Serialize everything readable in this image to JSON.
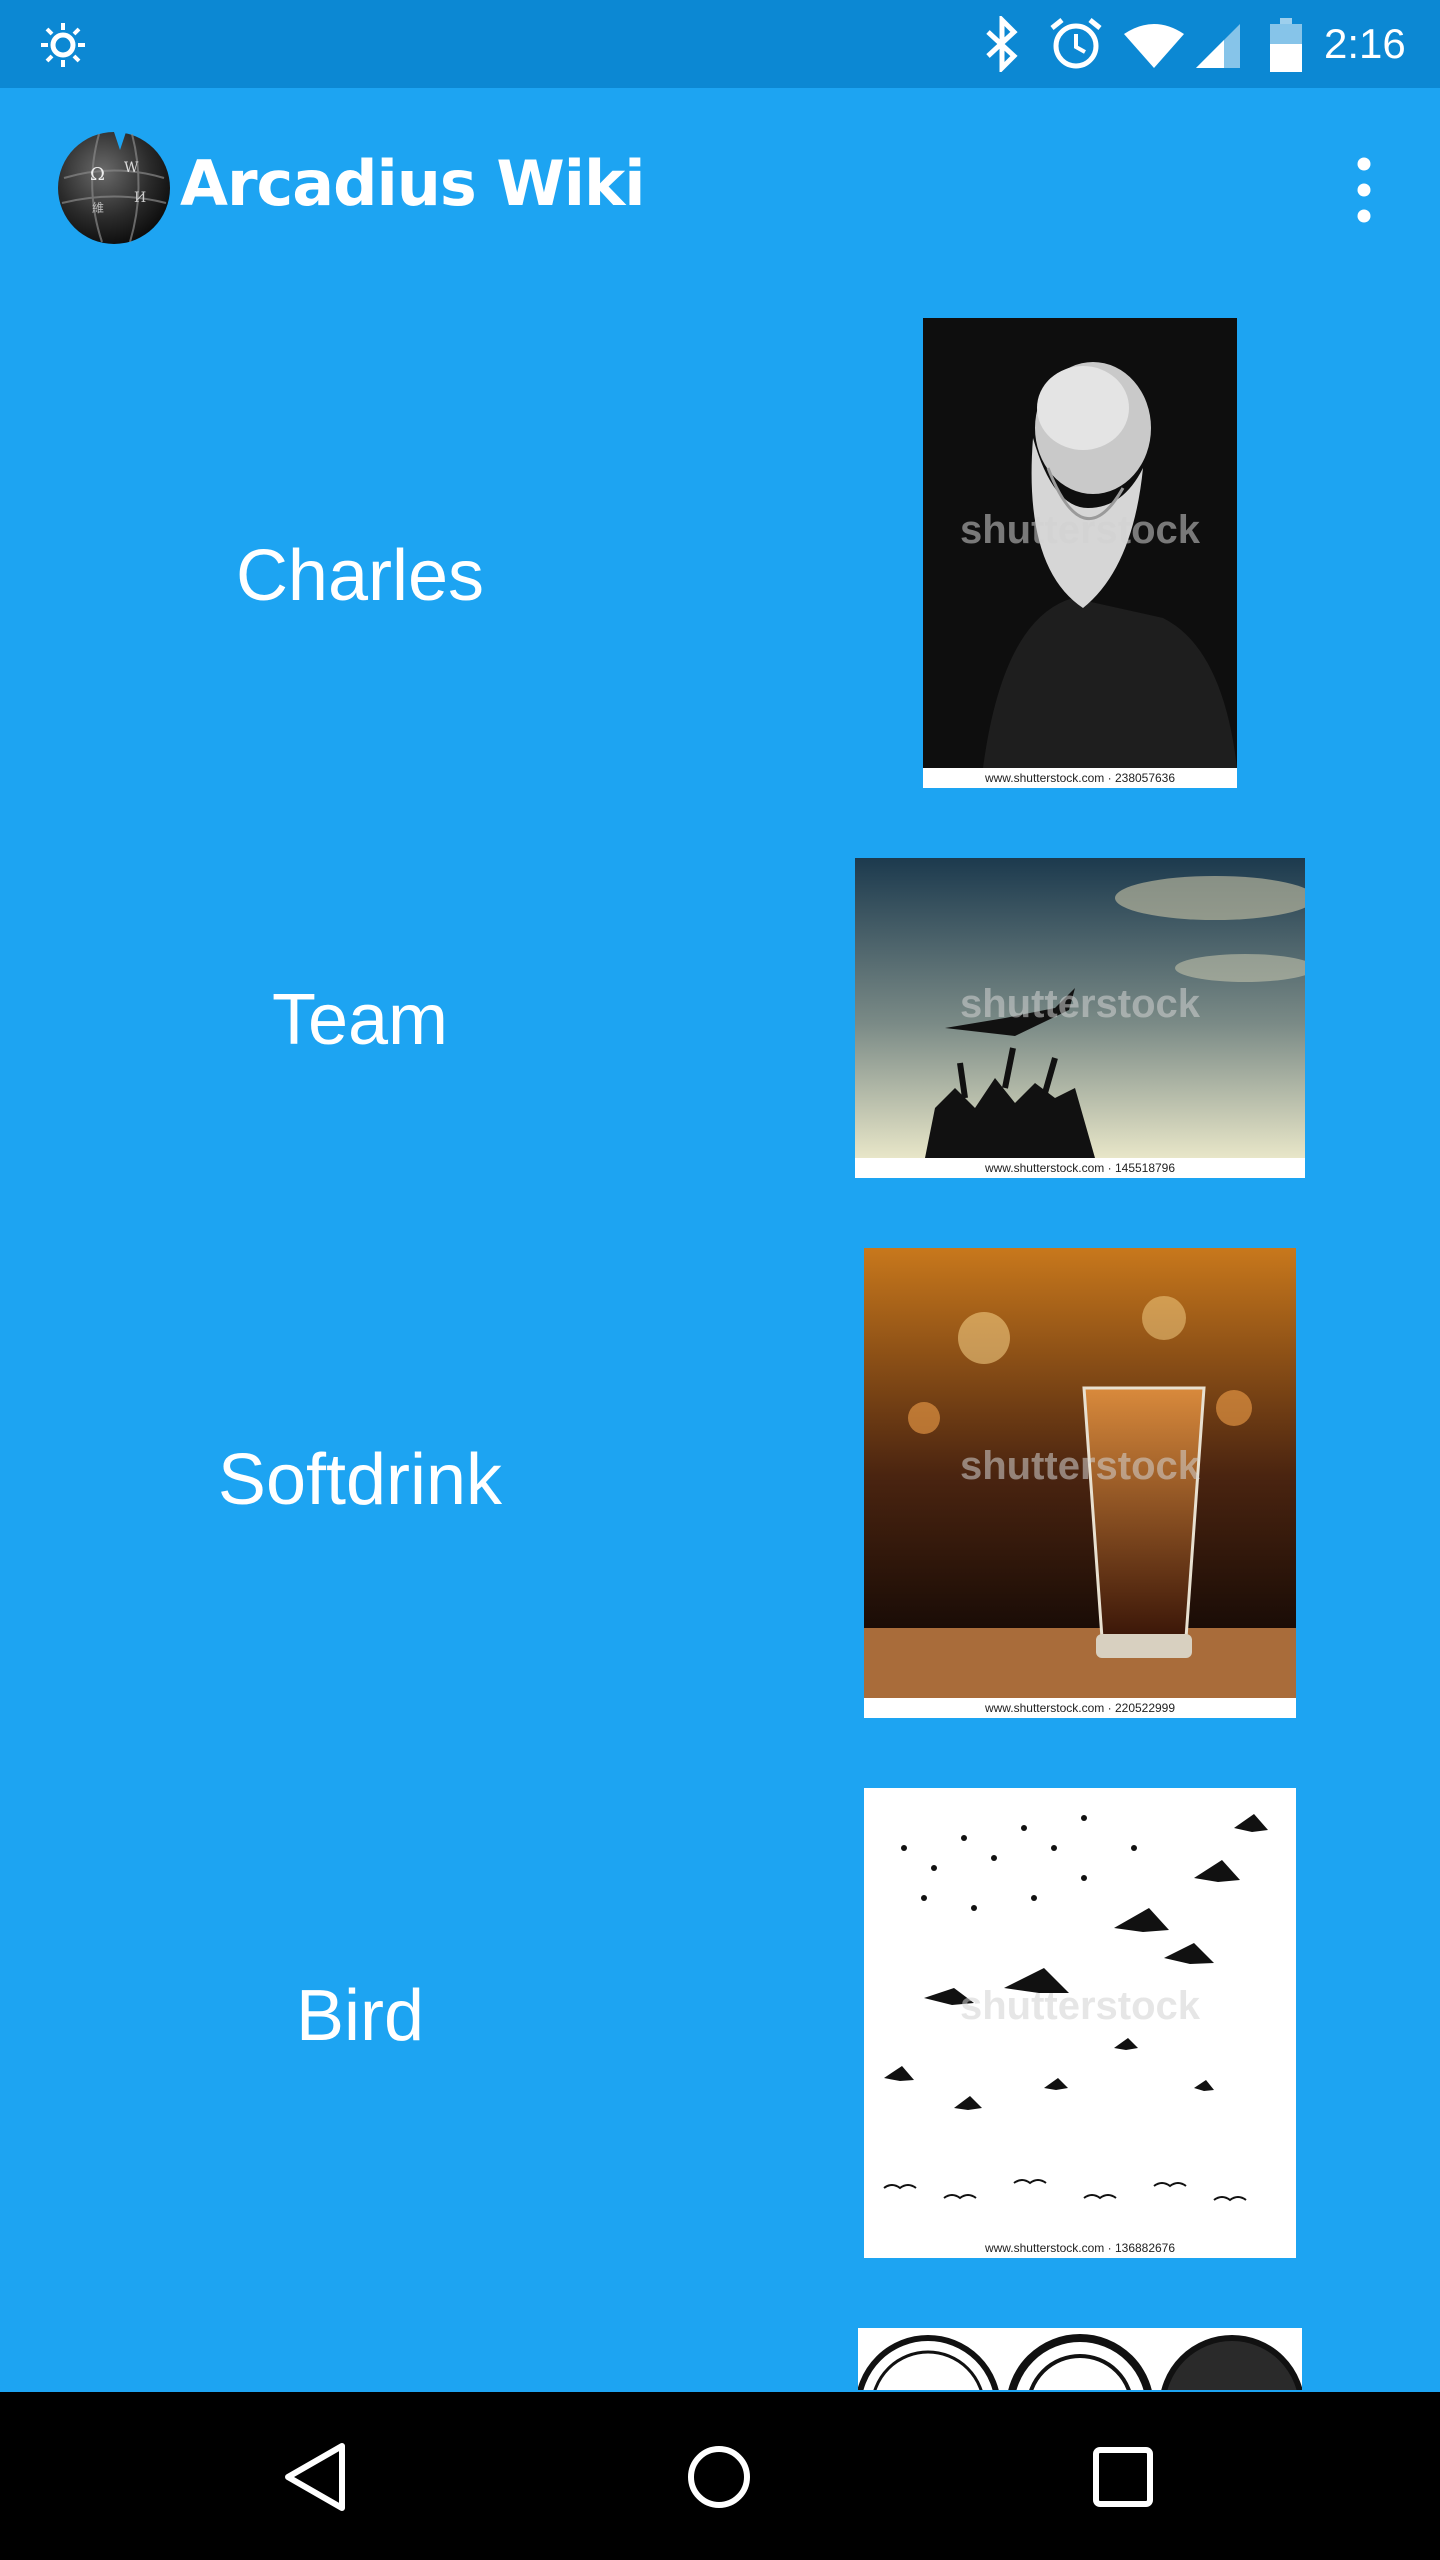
{
  "status_bar": {
    "time": "2:16",
    "icons": [
      "brightness-icon",
      "bluetooth-icon",
      "alarm-icon",
      "wifi-icon",
      "cell-signal-icon",
      "battery-icon"
    ]
  },
  "app_bar": {
    "title": "Arcadius Wiki",
    "logo": "wikipedia-globe-logo",
    "menu_icon": "overflow-menu-icon"
  },
  "items": [
    {
      "label": "Charles",
      "image": "portrait of bearded man",
      "watermark": "shutterstock",
      "credit": "www.shutterstock.com · 238057636"
    },
    {
      "label": "Team",
      "image": "crowd throwing person in air at sunset",
      "watermark": "shutterstock",
      "credit": "www.shutterstock.com · 145518796"
    },
    {
      "label": "Softdrink",
      "image": "glass of cola on bar",
      "watermark": "shutterstock",
      "credit": "www.shutterstock.com · 220522999"
    },
    {
      "label": "Bird",
      "image": "flock of bird silhouettes",
      "watermark": "shutterstock",
      "credit": "www.shutterstock.com · 136882676"
    }
  ],
  "colors": {
    "background": "#1da4f2",
    "status_bar": "#0c88d3",
    "nav_bar": "#000000",
    "text": "#ffffff"
  },
  "nav_bar": {
    "buttons": [
      "back-icon",
      "home-icon",
      "recents-icon"
    ]
  }
}
